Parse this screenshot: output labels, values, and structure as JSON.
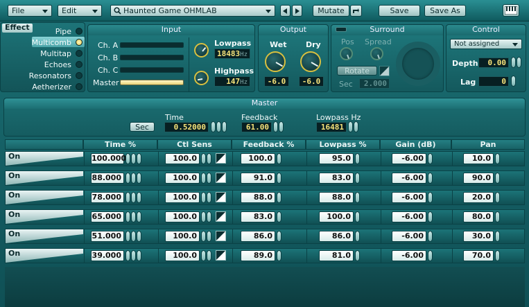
{
  "topbar": {
    "file_menu": "File",
    "edit_menu": "Edit",
    "preset_name": "Haunted Game OHMLAB",
    "mutate_label": "Mutate",
    "save_label": "Save",
    "save_as_label": "Save As"
  },
  "effect": {
    "tab_label": "Effect",
    "items": [
      {
        "label": "Pipe",
        "selected": false
      },
      {
        "label": "Multicomb",
        "selected": true
      },
      {
        "label": "Multitap",
        "selected": false
      },
      {
        "label": "Echoes",
        "selected": false
      },
      {
        "label": "Resonators",
        "selected": false
      },
      {
        "label": "Aetherizer",
        "selected": false
      }
    ]
  },
  "input": {
    "title": "Input",
    "channels": [
      "Ch. A",
      "Ch. B",
      "Ch. C",
      "Master"
    ],
    "lowpass_label": "Lowpass",
    "lowpass_value": "18483",
    "lowpass_unit": "Hz",
    "highpass_label": "Highpass",
    "highpass_value": "147",
    "highpass_unit": "Hz"
  },
  "output": {
    "title": "Output",
    "wet_label": "Wet",
    "wet_value": "-6.0",
    "dry_label": "Dry",
    "dry_value": "-6.0"
  },
  "surround": {
    "title": "Surround",
    "pos_label": "Pos",
    "spread_label": "Spread",
    "rotate_label": "Rotate",
    "sec_label": "Sec",
    "sec_value": "2.000"
  },
  "control": {
    "title": "Control",
    "assign_value": "Not assigned",
    "depth_label": "Depth",
    "depth_value": "0.00",
    "lag_label": "Lag",
    "lag_value": "0"
  },
  "master": {
    "title": "Master",
    "sec_button": "Sec",
    "time_label": "Time",
    "time_value": "0.52000",
    "feedback_label": "Feedback",
    "feedback_value": "61.00",
    "lowpass_label": "Lowpass Hz",
    "lowpass_value": "16481"
  },
  "table": {
    "headers": [
      "Time %",
      "Ctl Sens",
      "Feedback %",
      "Lowpass %",
      "Gain (dB)",
      "Pan"
    ],
    "rows": [
      {
        "on": "On",
        "time": "100.000",
        "ctl": "100.0",
        "feedback": "100.0",
        "lowpass": "95.0",
        "gain": "-6.00",
        "pan": "10.0"
      },
      {
        "on": "On",
        "time": "88.000",
        "ctl": "100.0",
        "feedback": "91.0",
        "lowpass": "83.0",
        "gain": "-6.00",
        "pan": "90.0"
      },
      {
        "on": "On",
        "time": "78.000",
        "ctl": "100.0",
        "feedback": "88.0",
        "lowpass": "88.0",
        "gain": "-6.00",
        "pan": "20.0"
      },
      {
        "on": "On",
        "time": "65.000",
        "ctl": "100.0",
        "feedback": "83.0",
        "lowpass": "100.0",
        "gain": "-6.00",
        "pan": "80.0"
      },
      {
        "on": "On",
        "time": "51.000",
        "ctl": "100.0",
        "feedback": "86.0",
        "lowpass": "86.0",
        "gain": "-6.00",
        "pan": "30.0"
      },
      {
        "on": "On",
        "time": "39.000",
        "ctl": "100.0",
        "feedback": "89.0",
        "lowpass": "81.0",
        "gain": "-6.00",
        "pan": "70.0"
      }
    ]
  },
  "icons": {
    "preset_search": "search-icon",
    "prev": "chevron-left-icon",
    "next": "chevron-right-icon",
    "mutate_extra": "mutate-icon",
    "keyboard": "keyboard-icon"
  },
  "colors": {
    "accent": "#f5e27a",
    "panel": "#1f7a7e",
    "background": "#0b3a3f"
  }
}
